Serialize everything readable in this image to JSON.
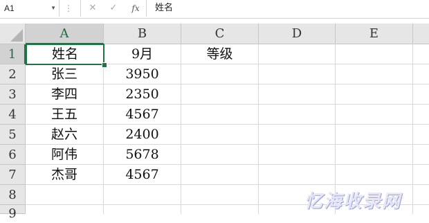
{
  "formula_bar": {
    "name_box": "A1",
    "name_box_dropdown_icon": "chevron-down-icon",
    "separator_icon": "more-vertical-icon",
    "cancel_icon": "close-icon",
    "enter_icon": "check-icon",
    "function_label": "fx",
    "cancel_glyph": "✕",
    "enter_glyph": "✓",
    "content": "姓名"
  },
  "sheet": {
    "columns": [
      "A",
      "B",
      "C",
      "D",
      "E"
    ],
    "rows": [
      "1",
      "2",
      "3",
      "4",
      "5",
      "6",
      "7",
      "8",
      "9"
    ],
    "cells": {
      "A1": "姓名",
      "B1": "9月",
      "C1": "等级",
      "A2": "张三",
      "B2": "3950",
      "A3": "李四",
      "B3": "2350",
      "A4": "王五",
      "B4": "4567",
      "A5": "赵六",
      "B5": "2400",
      "A6": "阿伟",
      "B6": "5678",
      "A7": "杰哥",
      "B7": "4567"
    },
    "active_cell": "A1",
    "accent_color": "#217346"
  },
  "watermark": {
    "text": "忆海收录网"
  }
}
